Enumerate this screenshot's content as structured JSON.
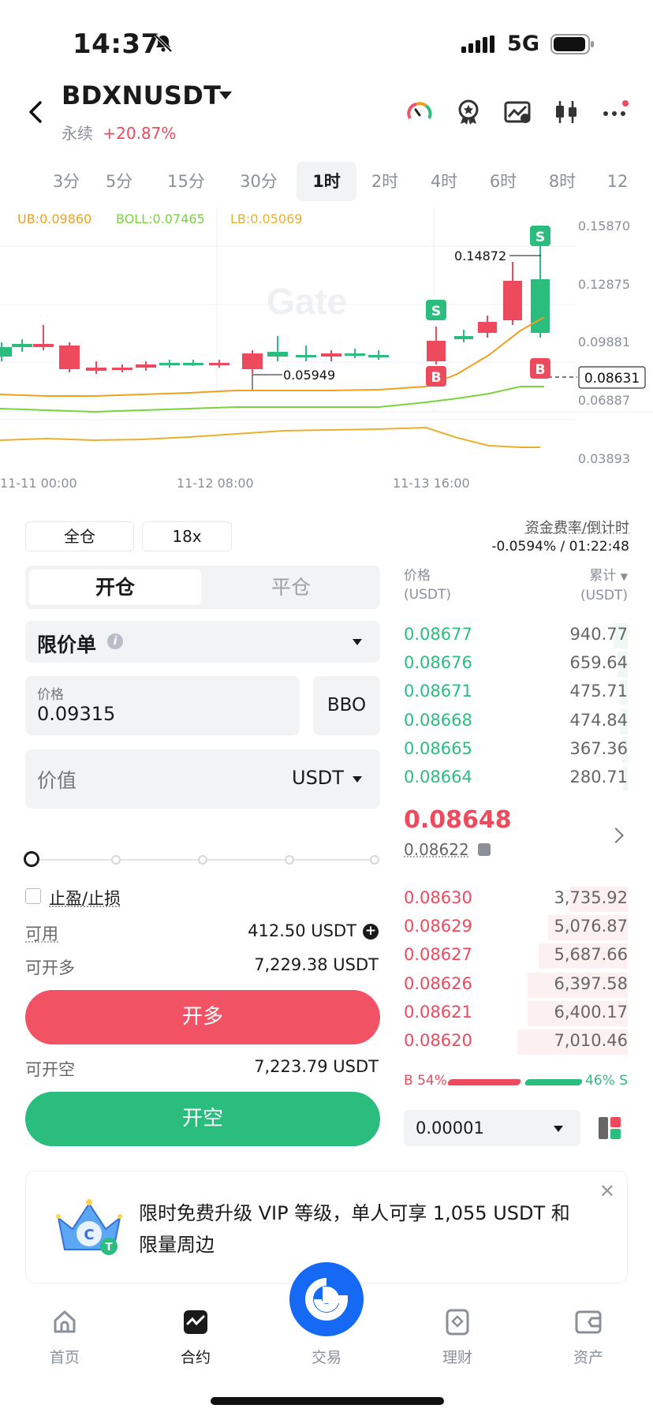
{
  "status": {
    "time": "14:37",
    "network": "5G"
  },
  "header": {
    "pair": "BDXNUSDT",
    "contract_type": "永续",
    "change": "+20.87%"
  },
  "timeframes": [
    "3分",
    "5分",
    "15分",
    "30分",
    "1时",
    "2时",
    "4时",
    "6时",
    "8时",
    "12"
  ],
  "timeframe_active": "1时",
  "chart": {
    "indicators": {
      "ub": "UB:0.09860",
      "boll": "BOLL:0.07465",
      "lb": "LB:0.05069"
    },
    "y_ticks": [
      "0.15870",
      "0.12875",
      "0.09881",
      "0.06887",
      "0.03893"
    ],
    "x_ticks": [
      "11-11 00:00",
      "11-12 08:00",
      "11-13 16:00"
    ],
    "current_price": "0.08631",
    "high_label": "0.14872",
    "low_label": "0.05949",
    "buy_marker": "B",
    "sell_marker": "S",
    "watermark": "Gate"
  },
  "margin": {
    "mode": "全仓",
    "leverage": "18x"
  },
  "funding": {
    "label": "资金费率/倒计时",
    "value": "-0.0594% / 01:22:48"
  },
  "position_tabs": {
    "open": "开仓",
    "close": "平仓"
  },
  "order": {
    "type": "限价单",
    "price_label": "价格",
    "price_value": "0.09315",
    "bbo": "BBO",
    "value_label": "价值",
    "value_unit": "USDT",
    "tpsl": "止盈/止损",
    "available_label": "可用",
    "available_value": "412.50 USDT",
    "max_long_label": "可开多",
    "max_long_value": "7,229.38 USDT",
    "long_button": "开多",
    "max_short_label": "可开空",
    "max_short_value": "7,223.79 USDT",
    "short_button": "开空"
  },
  "orderbook": {
    "price_header": "价格",
    "price_unit": "(USDT)",
    "total_header": "累计",
    "total_unit": "(USDT)",
    "asks": [
      {
        "price": "0.08677",
        "total": "940.77",
        "depth": 0.13
      },
      {
        "price": "0.08676",
        "total": "659.64",
        "depth": 0.09
      },
      {
        "price": "0.08671",
        "total": "475.71",
        "depth": 0.07
      },
      {
        "price": "0.08668",
        "total": "474.84",
        "depth": 0.07
      },
      {
        "price": "0.08665",
        "total": "367.36",
        "depth": 0.05
      },
      {
        "price": "0.08664",
        "total": "280.71",
        "depth": 0.04
      }
    ],
    "last_price": "0.08648",
    "mark_price": "0.08622",
    "bids": [
      {
        "price": "0.08630",
        "total": "3,735.92",
        "depth": 0.53
      },
      {
        "price": "0.08629",
        "total": "5,076.87",
        "depth": 0.72
      },
      {
        "price": "0.08627",
        "total": "5,687.66",
        "depth": 0.81
      },
      {
        "price": "0.08626",
        "total": "6,397.58",
        "depth": 0.91
      },
      {
        "price": "0.08621",
        "total": "6,400.17",
        "depth": 0.91
      },
      {
        "price": "0.08620",
        "total": "7,010.46",
        "depth": 1.0
      }
    ],
    "buy_ratio": "B 54%",
    "sell_ratio": "46% S",
    "precision": "0.00001"
  },
  "banner": {
    "text": "限时免费升级 VIP 等级，单人可享 1,055 USDT 和限量周边"
  },
  "nav": [
    {
      "label": "首页",
      "icon": "home-icon"
    },
    {
      "label": "合约",
      "icon": "futures-icon"
    },
    {
      "label": "交易",
      "icon": "gate-logo-icon"
    },
    {
      "label": "理财",
      "icon": "finance-icon"
    },
    {
      "label": "资产",
      "icon": "assets-icon"
    }
  ],
  "colors": {
    "up": "#2bbd7e",
    "down": "#ee4a5d",
    "accent": "#1669f5",
    "ub": "#f0a020",
    "boll": "#7ad23c",
    "lb": "#e8b030"
  }
}
